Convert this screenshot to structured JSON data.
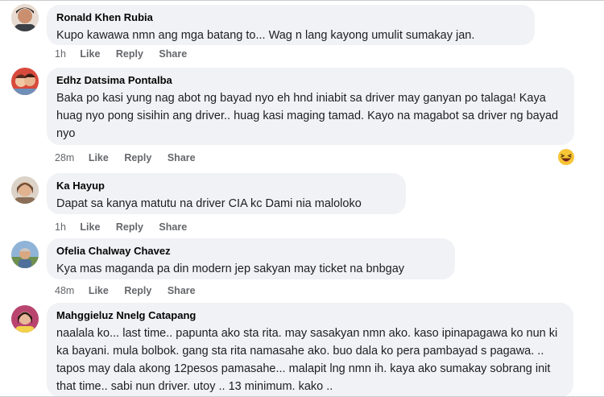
{
  "comments": [
    {
      "author": "Ronald Khen Rubia",
      "text": "Kupo kawawa nmn ang mga batang to... Wag n lang kayong umulit sumakay jan.",
      "time": "1h",
      "like": "Like",
      "reply": "Reply",
      "share": "Share"
    },
    {
      "author": "Edhz Datsima Pontalba",
      "text": "Baka po kasi yung nag abot ng bayad nyo eh hnd iniabit sa driver may ganyan po talaga! Kaya huag nyo pong sisihin ang driver.. huag kasi maging tamad. Kayo na magabot sa driver ng bayad nyo",
      "time": "28m",
      "like": "Like",
      "reply": "Reply",
      "share": "Share",
      "reaction_icon": "laughing-emoji-icon"
    },
    {
      "author": "Ka Hayup",
      "text": "Dapat sa kanya matutu na driver CIA kc Dami nia maloloko",
      "time": "1h",
      "like": "Like",
      "reply": "Reply",
      "share": "Share"
    },
    {
      "author": "Ofelia Chalway Chavez",
      "text": "Kya mas maganda pa din modern jep sakyan may ticket na bnbgay",
      "time": "48m",
      "like": "Like",
      "reply": "Reply",
      "share": "Share"
    },
    {
      "author": "Mahggieluz Nnelg Catapang",
      "text": "naalala ko... last time.. papunta ako sta rita. may sasakyan nmn ako. kaso ipinapagawa ko nun ki ka bayani. mula bolbok. gang sta rita namasahe ako. buo dala ko pera pambayad s pagawa. .. tapos may dala akong 12pesos pamasahe... malapit lng nmn ih. kaya ako sumakay sobrang init that time.. sabi nun driver. utoy .. 13 minimum. kako .."
    }
  ],
  "colors": {
    "bubble": "#f0f2f5",
    "meta": "#65676b"
  }
}
